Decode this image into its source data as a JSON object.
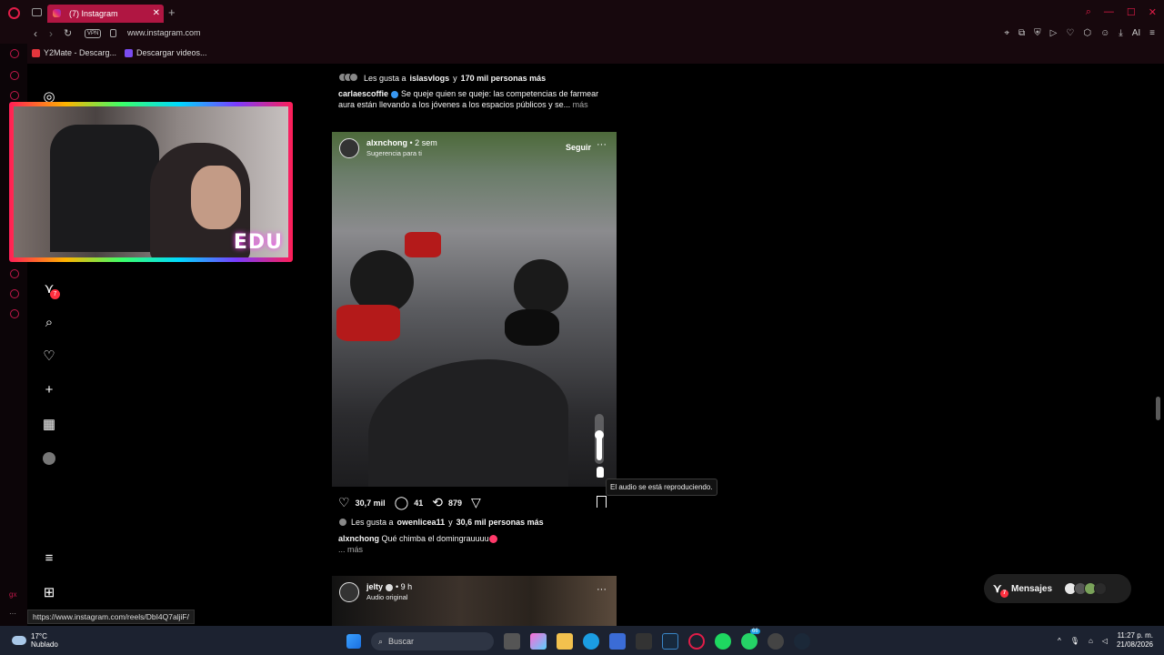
{
  "browser": {
    "tab_title": "(7) Instagram",
    "url": "www.instagram.com",
    "vpn_label": "VPN",
    "ai_label": "AI",
    "bookmarks": [
      {
        "label": "Y2Mate - Descarg...",
        "color": "#e4363d"
      },
      {
        "label": "Descargar videos...",
        "color": "#7a4cf0"
      }
    ],
    "status_url": "https://www.instagram.com/reels/DbI4Q7aljiF/"
  },
  "webcam": {
    "overlay_text": "EDU"
  },
  "sidebar": {
    "notifications_badge": "7"
  },
  "feed": {
    "post1_tail": {
      "liked_by_prefix": "Les gusta a",
      "liked_by_user": "islasvlogs",
      "liked_by_conj": "y",
      "liked_by_count": "170 mil personas más",
      "caption_user": "carlaescoffie",
      "caption_text": "Se queje quien se queje: las competencias de farmear aura están llevando a los jóvenes a los espacios públicos y se...",
      "more": "más"
    },
    "post2": {
      "username": "alxnchong",
      "time": "• 2 sem",
      "subtitle": "Sugerencia para ti",
      "follow": "Seguir",
      "more_icon": "···",
      "likes": "30,7 mil",
      "comments": "41",
      "reposts": "879",
      "volume_level": 0.6,
      "tooltip": "El audio se está reproduciendo.",
      "liked_by_prefix": "Les gusta a",
      "liked_by_user": "owenlicea11",
      "liked_by_conj": "y",
      "liked_by_count": "30,6 mil personas más",
      "caption_user": "alxnchong",
      "caption_text": "Qué chimba el domingrauuuu",
      "more": "... más"
    },
    "post3": {
      "username": "jelty",
      "time": "• 9 h",
      "subtitle": "Audio original",
      "more_icon": "···"
    }
  },
  "messages": {
    "label": "Mensajes",
    "badge": "7"
  },
  "taskbar": {
    "temperature": "17°C",
    "weather": "Nublado",
    "search_placeholder": "Buscar",
    "time": "11:27 p. m.",
    "date": "21/08/2026",
    "whatsapp_badge": "66"
  }
}
